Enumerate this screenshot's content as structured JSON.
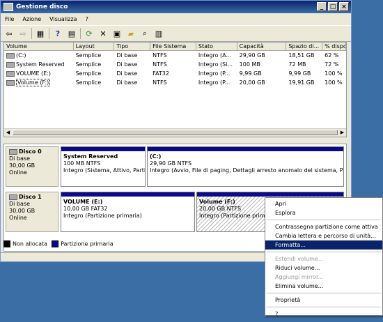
{
  "window": {
    "title": "Gestione disco"
  },
  "menubar": {
    "items": [
      "File",
      "Azione",
      "Visualizza",
      "?"
    ]
  },
  "toolbar": {
    "icons": [
      "back-arrow-icon",
      "forward-arrow-icon",
      "properties-icon",
      "help-icon",
      "refresh-icon",
      "delete-icon",
      "properties2-icon",
      "open-folder-icon",
      "search-icon",
      "drive-list-icon"
    ]
  },
  "volumes": {
    "columns": [
      "Volume",
      "Layout",
      "Tipo",
      "File Sistema",
      "Stato",
      "Capacità",
      "Spazio di...",
      "% disponibile"
    ],
    "rows": [
      [
        "(C:)",
        "Semplice",
        "Di base",
        "NTFS",
        "Integro (A...",
        "29,90 GB",
        "18,51 GB",
        "62 %"
      ],
      [
        "System Reserved",
        "Semplice",
        "Di base",
        "NTFS",
        "Integro (Si...",
        "100 MB",
        "72 MB",
        "72 %"
      ],
      [
        "VOLUME (E:)",
        "Semplice",
        "Di base",
        "FAT32",
        "Integro (P...",
        "9,99 GB",
        "9,99 GB",
        "100 %"
      ],
      [
        "Volume (F:)",
        "Semplice",
        "Di base",
        "NTFS",
        "Integro (P...",
        "20,00 GB",
        "19,91 GB",
        "100 %"
      ]
    ]
  },
  "disks": [
    {
      "name": "Disco 0",
      "type": "Di base",
      "size": "30,00 GB",
      "status": "Online",
      "partitions": [
        {
          "name": "System Reserved",
          "info": "100 MB NTFS",
          "status": "Integro (Sistema, Attivo, Parti"
        },
        {
          "name": "(C:)",
          "info": "29,90 GB NTFS",
          "status": "Integro (Avvio, File di paging, Dettagli arresto anomalo del sistema, Parti"
        }
      ]
    },
    {
      "name": "Disco 1",
      "type": "Di base",
      "size": "30,00 GB",
      "status": "Online",
      "partitions": [
        {
          "name": "VOLUME  (E:)",
          "info": "10,00 GB FAT32",
          "status": "Integro (Partizione primaria)"
        },
        {
          "name": "Volume  (F:)",
          "info": "20,00 GB NTFS",
          "status": "Integro (Partizione primaria"
        }
      ]
    }
  ],
  "legend": {
    "unallocated": "Non allocata",
    "primary": "Partizione primaria",
    "unallocated_color": "#000000",
    "primary_color": "#0a0a8a"
  },
  "context_menu": {
    "items": [
      "Apri",
      "Esplora",
      "Contrassegna partizione come attiva",
      "Cambia lettera e percorso di unità...",
      "Formatta...",
      "Estendi volume...",
      "Riduci volume...",
      "Aggiungi mirror...",
      "Elimina volume...",
      "Proprietà",
      "?"
    ],
    "selected": "Formatta..."
  }
}
